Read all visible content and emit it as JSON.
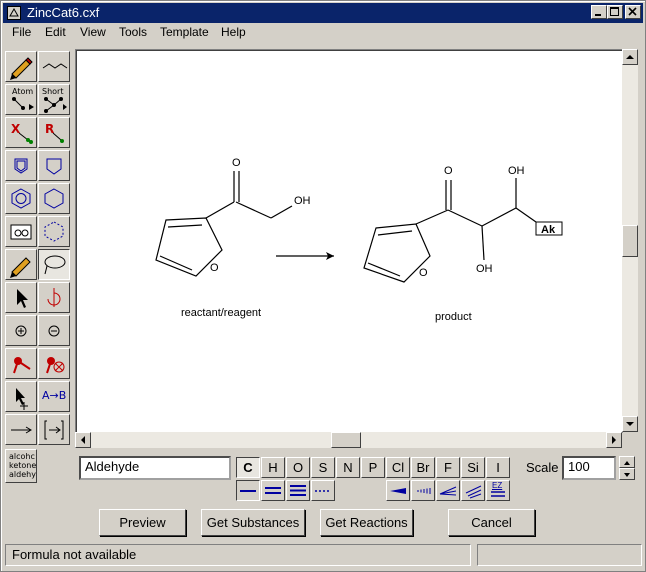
{
  "window": {
    "title": "ZincCat6.cxf"
  },
  "menu": [
    "File",
    "Edit",
    "View",
    "Tools",
    "Template",
    "Help"
  ],
  "tools": {
    "atom_label": "Atom",
    "short_label": "Short",
    "x_label": "X",
    "r_label": "R",
    "ab_label": "A→B",
    "group_lines": [
      "alcohc",
      "ketone",
      "aldehy"
    ]
  },
  "canvas": {
    "reactant_caption": "reactant/reagent",
    "product_caption": "product",
    "labels": {
      "oh": "OH",
      "o": "O",
      "ak": "Ak"
    }
  },
  "template_field": {
    "value": "Aldehyde"
  },
  "atoms": [
    "C",
    "H",
    "O",
    "S",
    "N",
    "P",
    "Cl",
    "Br",
    "F",
    "Si",
    "I"
  ],
  "selected_atom": "C",
  "bonds": [
    "single",
    "double",
    "triple",
    "any",
    "wedge-up",
    "wedge-down",
    "wedge-either",
    "hash",
    "ez"
  ],
  "ez_label": "EZ",
  "scale": {
    "label": "Scale",
    "value": "100"
  },
  "buttons": {
    "preview": "Preview",
    "get_substances": "Get Substances",
    "get_reactions": "Get Reactions",
    "cancel": "Cancel"
  },
  "status": {
    "text": "Formula not available"
  }
}
